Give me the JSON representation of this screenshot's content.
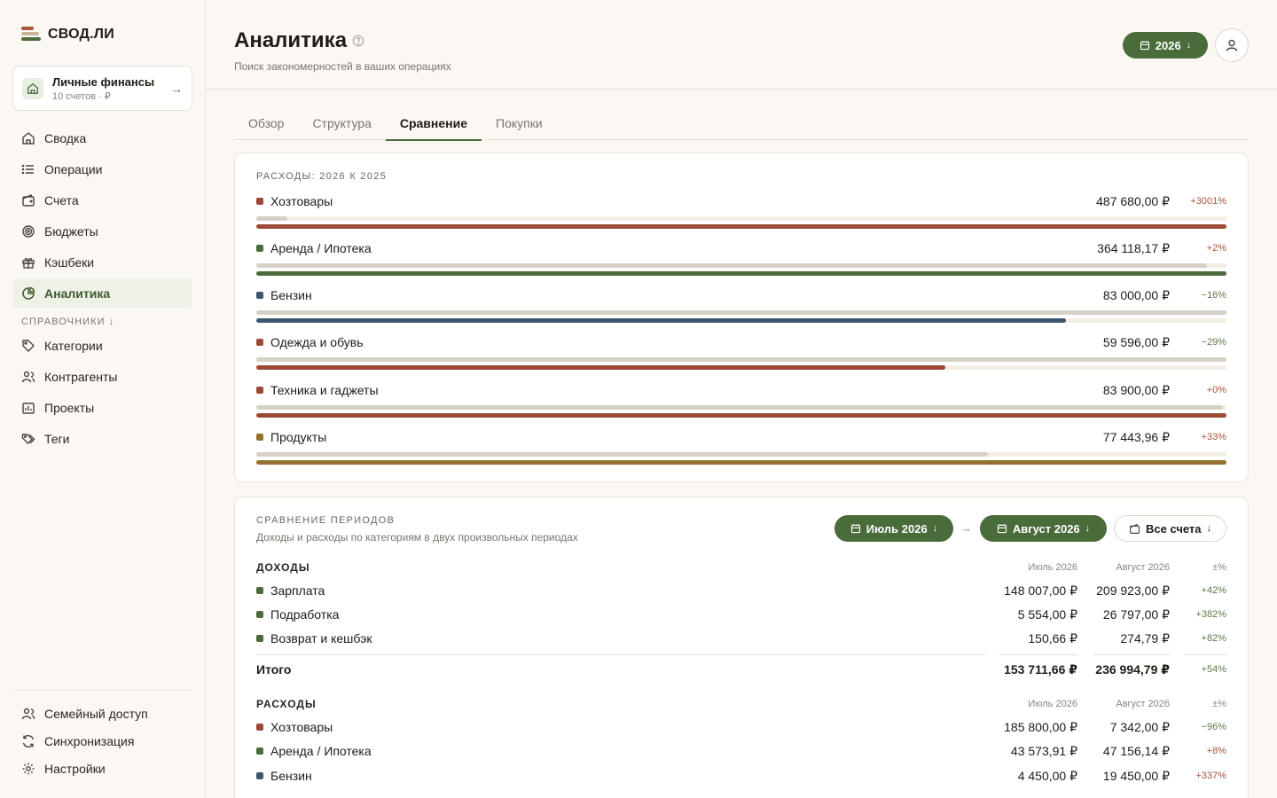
{
  "app": {
    "name": "СВОД.ЛИ"
  },
  "workspace": {
    "title": "Личные финансы",
    "subtitle": "10 счетов · ₽"
  },
  "nav": {
    "main": [
      {
        "label": "Сводка",
        "icon": "home-icon"
      },
      {
        "label": "Операции",
        "icon": "list-icon"
      },
      {
        "label": "Счета",
        "icon": "wallet-icon"
      },
      {
        "label": "Бюджеты",
        "icon": "target-icon"
      },
      {
        "label": "Кэшбеки",
        "icon": "gift-icon"
      },
      {
        "label": "Аналитика",
        "icon": "pie-chart-icon",
        "active": true
      }
    ],
    "section_label": "Справочники ↓",
    "refs": [
      {
        "label": "Категории",
        "icon": "tag-icon"
      },
      {
        "label": "Контрагенты",
        "icon": "users-icon"
      },
      {
        "label": "Проекты",
        "icon": "project-icon"
      },
      {
        "label": "Теги",
        "icon": "tags-icon"
      }
    ],
    "bottom": [
      {
        "label": "Семейный доступ",
        "icon": "family-icon"
      },
      {
        "label": "Синхронизация",
        "icon": "sync-icon"
      },
      {
        "label": "Настройки",
        "icon": "gear-icon"
      }
    ]
  },
  "header": {
    "title": "Аналитика",
    "subtitle": "Поиск закономерностей в ваших операциях",
    "year": "2026"
  },
  "tabs": [
    {
      "label": "Обзор"
    },
    {
      "label": "Структура"
    },
    {
      "label": "Сравнение",
      "active": true
    },
    {
      "label": "Покупки"
    }
  ],
  "comparison": {
    "title": "Расходы: 2026 к 2025",
    "rows": [
      {
        "name": "Хозтовары",
        "amount": "487 680,00 ₽",
        "pct": "+3001%",
        "color": "#9c4a35",
        "prev_share": 0.032,
        "cur_share": 1.0,
        "pct_color": "#a8553c"
      },
      {
        "name": "Аренда / Ипотека",
        "amount": "364 118,17 ₽",
        "pct": "+2%",
        "color": "#4a6b3a",
        "prev_share": 0.98,
        "cur_share": 1.0,
        "pct_color": "#a8553c"
      },
      {
        "name": "Бензин",
        "amount": "83 000,00 ₽",
        "pct": "−16%",
        "color": "#3d5670",
        "prev_share": 1.0,
        "cur_share": 0.835,
        "pct_color": "#5e7a4a"
      },
      {
        "name": "Одежда и обувь",
        "amount": "59 596,00 ₽",
        "pct": "−29%",
        "color": "#9c4a35",
        "prev_share": 1.0,
        "cur_share": 0.71,
        "pct_color": "#5e7a4a"
      },
      {
        "name": "Техника и гаджеты",
        "amount": "83 900,00 ₽",
        "pct": "+0%",
        "color": "#9c4a35",
        "prev_share": 0.996,
        "cur_share": 1.0,
        "pct_color": "#a8553c"
      },
      {
        "name": "Продукты",
        "amount": "77 443,96 ₽",
        "pct": "+33%",
        "color": "#94712e",
        "prev_share": 0.754,
        "cur_share": 1.0,
        "pct_color": "#a8553c"
      }
    ]
  },
  "periods": {
    "title": "Сравнение периодов",
    "subtitle": "Доходы и расходы по категориям в двух произвольных периодах",
    "period_a": "Июль 2026",
    "period_b": "Август 2026",
    "accounts": "Все счета",
    "col_a": "Июль 2026",
    "col_b": "Август 2026",
    "col_pct": "±%",
    "income": {
      "label": "Доходы",
      "rows": [
        {
          "name": "Зарплата",
          "a": "148 007,00 ₽",
          "b": "209 923,00 ₽",
          "pct": "+42%",
          "color": "#4a6b3a",
          "pct_color": "#5e7a4a"
        },
        {
          "name": "Подработка",
          "a": "5 554,00 ₽",
          "b": "26 797,00 ₽",
          "pct": "+382%",
          "color": "#4a6b3a",
          "pct_color": "#5e7a4a"
        },
        {
          "name": "Возврат и кешбэк",
          "a": "150,66 ₽",
          "b": "274,79 ₽",
          "pct": "+82%",
          "color": "#4a6b3a",
          "pct_color": "#5e7a4a"
        }
      ],
      "total": {
        "name": "Итого",
        "a": "153 711,66 ₽",
        "b": "236 994,79 ₽",
        "pct": "+54%",
        "pct_color": "#5e7a4a"
      }
    },
    "expense": {
      "label": "Расходы",
      "rows": [
        {
          "name": "Хозтовары",
          "a": "185 800,00 ₽",
          "b": "7 342,00 ₽",
          "pct": "−96%",
          "color": "#9c4a35",
          "pct_color": "#5e7a4a"
        },
        {
          "name": "Аренда / Ипотека",
          "a": "43 573,91 ₽",
          "b": "47 156,14 ₽",
          "pct": "+8%",
          "color": "#4a6b3a",
          "pct_color": "#a8553c"
        },
        {
          "name": "Бензин",
          "a": "4 450,00 ₽",
          "b": "19 450,00 ₽",
          "pct": "+337%",
          "color": "#3d5670",
          "pct_color": "#a8553c"
        }
      ]
    }
  }
}
